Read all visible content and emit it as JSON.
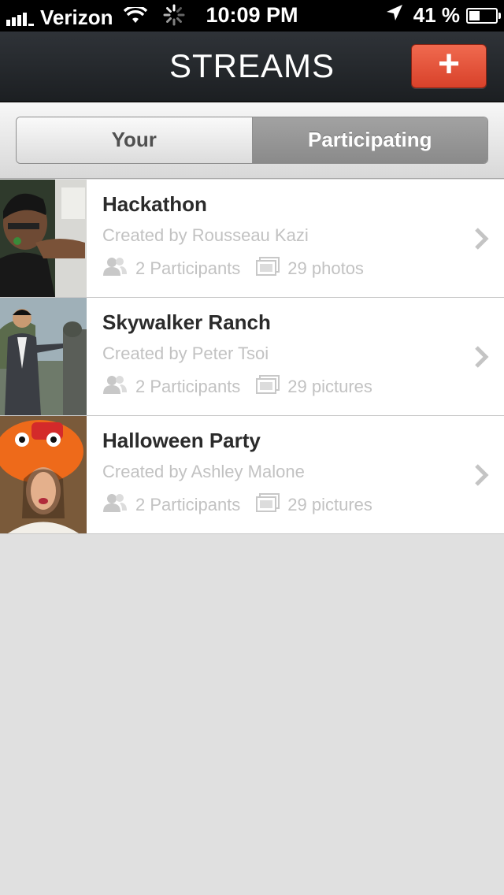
{
  "status_bar": {
    "carrier": "Verizon",
    "time": "10:09 PM",
    "battery_percent": "41 %",
    "battery_level": 0.41,
    "icons": [
      "signal-icon",
      "wifi-icon",
      "activity-spinner-icon",
      "location-arrow-icon",
      "battery-icon"
    ]
  },
  "nav": {
    "title": "STREAMS",
    "add_label": "+",
    "add_color": "#e8502f"
  },
  "segments": {
    "your": "Your",
    "participating": "Participating",
    "selected": "participating"
  },
  "streams": [
    {
      "title": "Hackathon",
      "creator": "Created by Rousseau Kazi",
      "participants": "2 Participants",
      "media": "29 photos"
    },
    {
      "title": "Skywalker Ranch",
      "creator": "Created by Peter Tsoi",
      "participants": "2 Participants",
      "media": "29 pictures"
    },
    {
      "title": "Halloween Party",
      "creator": "Created by Ashley Malone",
      "participants": "2 Participants",
      "media": "29 pictures"
    }
  ],
  "colors": {
    "accent": "#e8502f",
    "navbar": "#25292d",
    "background": "#e0e0e0"
  }
}
